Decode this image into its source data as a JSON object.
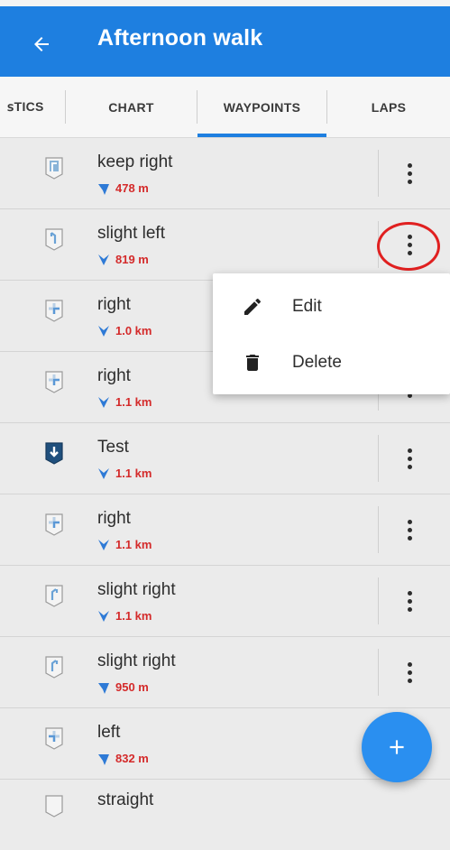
{
  "header": {
    "title": "Afternoon walk",
    "back_icon": "arrow-left-icon",
    "color": "#1e7fe0"
  },
  "tabs": [
    {
      "label": "ꜱTICS",
      "active": false
    },
    {
      "label": "CHART",
      "active": false
    },
    {
      "label": "WAYPOINTS",
      "active": true
    },
    {
      "label": "LAPS",
      "active": false
    }
  ],
  "waypoints": [
    {
      "name": "keep right",
      "distance": "478 m",
      "icon": "keep-right-icon"
    },
    {
      "name": "slight left",
      "distance": "819 m",
      "icon": "slight-left-icon"
    },
    {
      "name": "right",
      "distance": "1.0 km",
      "icon": "turn-right-icon"
    },
    {
      "name": "right",
      "distance": "1.1 km",
      "icon": "turn-right-icon"
    },
    {
      "name": "Test",
      "distance": "1.1 km",
      "icon": "download-waypoint-icon"
    },
    {
      "name": "right",
      "distance": "1.1 km",
      "icon": "turn-right-icon"
    },
    {
      "name": "slight right",
      "distance": "1.1 km",
      "icon": "slight-right-icon"
    },
    {
      "name": "slight right",
      "distance": "950 m",
      "icon": "slight-right-icon"
    },
    {
      "name": "left",
      "distance": "832 m",
      "icon": "turn-left-icon"
    },
    {
      "name": "straight",
      "distance": "",
      "icon": "straight-icon"
    }
  ],
  "context_menu": {
    "items": [
      {
        "label": "Edit",
        "icon": "pencil-icon"
      },
      {
        "label": "Delete",
        "icon": "trash-icon"
      }
    ]
  },
  "fab": {
    "icon": "plus-icon",
    "color": "#2a8ff0"
  },
  "colors": {
    "distance": "#d42a2a",
    "highlight": "#e02020"
  }
}
